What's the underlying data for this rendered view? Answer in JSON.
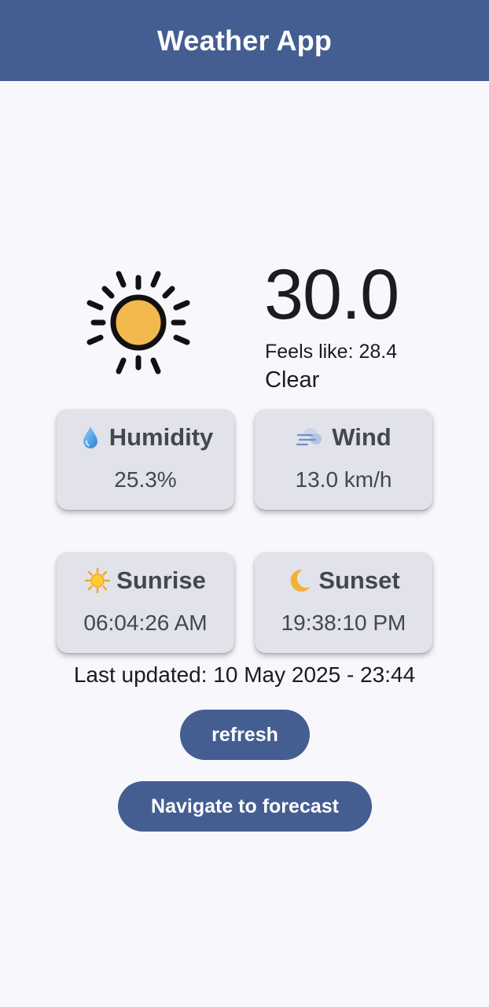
{
  "app_bar": {
    "title": "Weather App"
  },
  "current": {
    "icon": "sun-icon",
    "temperature": "30.0",
    "feels_like": "Feels like: 28.4",
    "condition": "Clear"
  },
  "cards": {
    "humidity": {
      "icon": "water-drop-icon",
      "title": "Humidity",
      "value": "25.3%"
    },
    "wind": {
      "icon": "wind-icon",
      "title": "Wind",
      "value": "13.0 km/h"
    },
    "sunrise": {
      "icon": "sun-small-icon",
      "title": "Sunrise",
      "value": "06:04:26 AM"
    },
    "sunset": {
      "icon": "crescent-moon-icon",
      "title": "Sunset",
      "value": "19:38:10 PM"
    }
  },
  "last_updated": "Last updated: 10 May 2025 - 23:44",
  "buttons": {
    "refresh": "refresh",
    "forecast": "Navigate to forecast"
  },
  "colors": {
    "primary": "#445e91",
    "card_background": "#e2e2ea",
    "page_background": "#f8f8fc",
    "sun_fill": "#f3b94f"
  }
}
